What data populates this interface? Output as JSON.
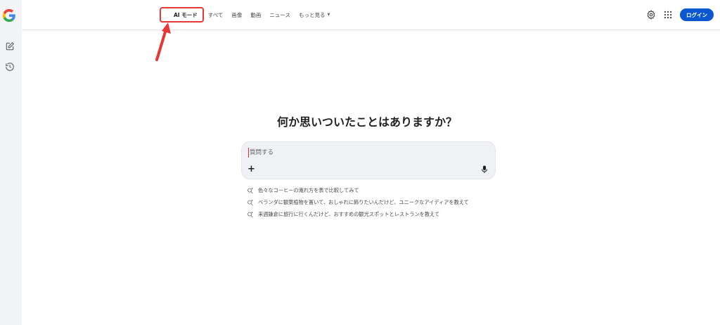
{
  "sidebar": {
    "logo": "google-g-logo",
    "items": [
      {
        "icon": "new-chat-icon"
      },
      {
        "icon": "history-icon"
      }
    ]
  },
  "header": {
    "tabs": [
      {
        "label": "AI モード",
        "active": true
      },
      {
        "label": "すべて"
      },
      {
        "label": "画像"
      },
      {
        "label": "動画"
      },
      {
        "label": "ニュース"
      },
      {
        "label": "もっと見る"
      }
    ],
    "login_label": "ログイン"
  },
  "main": {
    "heading": "何か思いついたことはありますか？",
    "search": {
      "placeholder": "質問する"
    },
    "suggestions": [
      "色々なコーヒーの淹れ方を表で比較してみて",
      "ベランダに観葉植物を置いて、おしゃれに飾りたいんだけど、ユニークなアイディアを教えて",
      "来週鎌倉に旅行に行くんだけど、おすすめの観光スポットとレストランを教えて"
    ]
  },
  "colors": {
    "accent": "#0b57d0",
    "annotation": "#e53935",
    "sidebar_bg": "#f3f4f6"
  }
}
